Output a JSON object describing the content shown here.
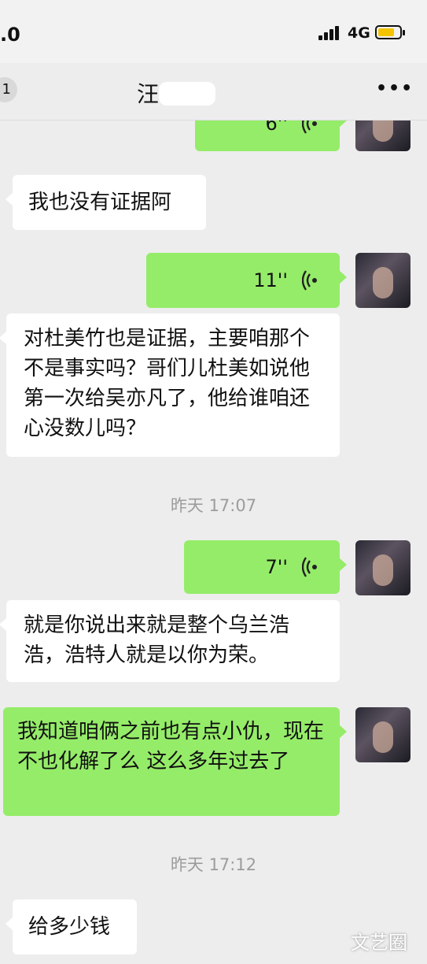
{
  "status_bar": {
    "time": ".0",
    "network": "4G",
    "signal_icon": "signal-bars-icon",
    "battery_icon": "battery-icon"
  },
  "nav": {
    "back_badge": "1",
    "title": "汪",
    "more_icon": "more-dots-icon"
  },
  "messages": [
    {
      "side": "out",
      "kind": "voice",
      "duration": "6''"
    },
    {
      "side": "in",
      "kind": "text",
      "text": "我也没有证据阿"
    },
    {
      "side": "out",
      "kind": "voice",
      "duration": "11''"
    },
    {
      "side": "in",
      "kind": "text",
      "text": "对杜美竹也是证据，主要咱那个不是事实吗？哥们儿杜美如说他第一次给吴亦凡了，他给谁咱还心没数儿吗？"
    },
    {
      "side": "system",
      "kind": "time",
      "text": "昨天 17:07"
    },
    {
      "side": "out",
      "kind": "voice",
      "duration": "7''"
    },
    {
      "side": "in",
      "kind": "text",
      "text": "就是你说出来就是整个乌兰浩浩，浩特人就是以你为荣。"
    },
    {
      "side": "out",
      "kind": "text",
      "text": "我知道咱俩之前也有点小仇，现在不也化解了么 这么多年过去了"
    },
    {
      "side": "system",
      "kind": "time",
      "text": "昨天 17:12"
    },
    {
      "side": "in",
      "kind": "text",
      "text": "给多少钱"
    }
  ],
  "watermark": "文艺圈",
  "colors": {
    "background": "#ededed",
    "outgoing_bubble": "#95ec69",
    "incoming_bubble": "#ffffff"
  }
}
